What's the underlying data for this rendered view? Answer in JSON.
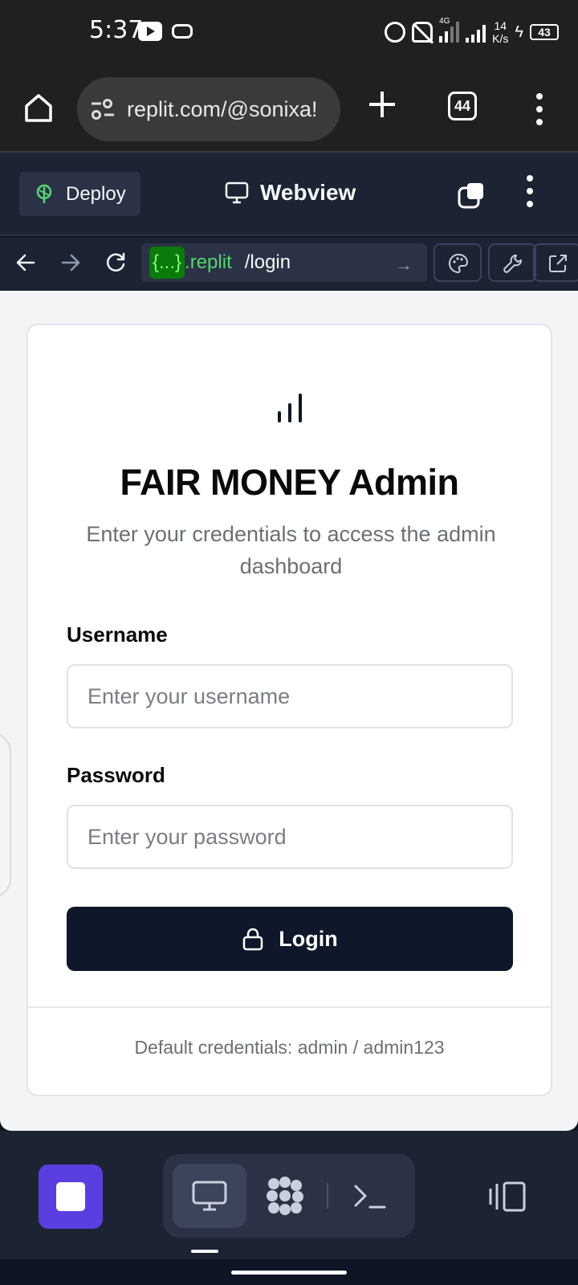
{
  "status_bar": {
    "time": "5:37",
    "net_speed_value": "14",
    "net_speed_unit": "K/s",
    "network_type": "4G",
    "battery": "43"
  },
  "browser": {
    "url": "replit.com/@sonixa!",
    "tab_count": "44"
  },
  "replit": {
    "deploy_label": "Deploy",
    "webview_label": "Webview",
    "url_token": "{...}",
    "url_host": ".replit",
    "url_path": "/login"
  },
  "login": {
    "title": "FAIR MONEY Admin",
    "subtitle": "Enter your credentials to access the admin dashboard",
    "username_label": "Username",
    "username_placeholder": "Enter your username",
    "password_label": "Password",
    "password_placeholder": "Enter your password",
    "login_button": "Login",
    "footer": "Default credentials: admin / admin123"
  },
  "colors": {
    "accent_purple": "#5b3ee0",
    "button_dark": "#0f172a",
    "replit_bg": "#1c2333"
  }
}
